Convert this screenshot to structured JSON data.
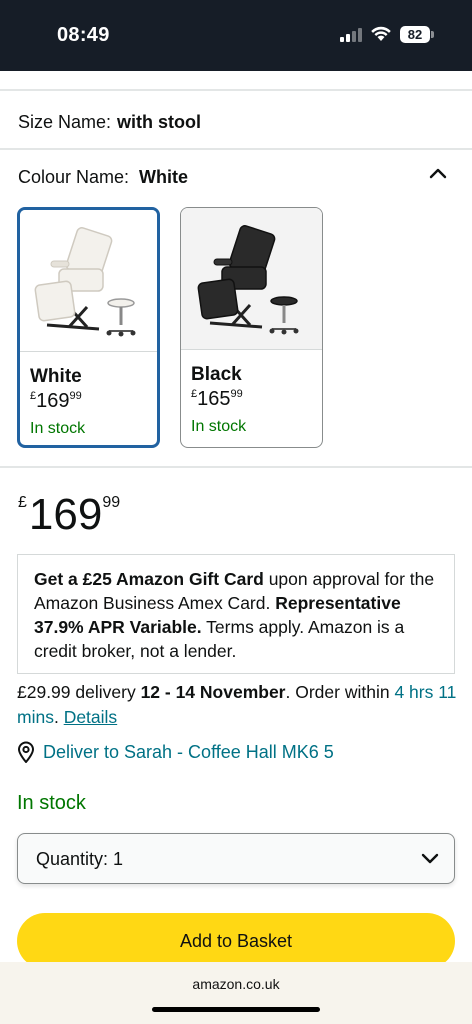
{
  "status_bar": {
    "time": "08:49",
    "battery": "82"
  },
  "size": {
    "label": "Size Name:",
    "value": "with stool"
  },
  "colour": {
    "label": "Colour Name:",
    "value": "White"
  },
  "swatches": [
    {
      "name": "White",
      "currency": "£",
      "price_whole": "169",
      "price_fraction": "99",
      "stock": "In stock",
      "selected": true,
      "chair_color": "#f3f1ec"
    },
    {
      "name": "Black",
      "currency": "£",
      "price_whole": "165",
      "price_fraction": "99",
      "stock": "In stock",
      "selected": false,
      "chair_color": "#2a2a2a"
    }
  ],
  "price": {
    "currency": "£",
    "whole": "169",
    "fraction": "99"
  },
  "promo": {
    "bold1": "Get a £25 Amazon Gift Card",
    "text1": " upon approval for the Amazon Business Amex Card. ",
    "bold2": "Representative 37.9% APR Variable.",
    "text2": " Terms apply. Amazon is a credit broker, not a lender."
  },
  "delivery": {
    "prefix": "£29.99 delivery ",
    "dates": "12 - 14 November",
    "middle": ". Order within ",
    "countdown": "4 hrs 11 mins",
    "sep": ". ",
    "details_link": "Details"
  },
  "deliver_to": "Deliver to Sarah - Coffee Hall MK6 5",
  "stock": "In stock",
  "quantity": "Quantity:  1",
  "add_to_basket": "Add to Basket",
  "url": "amazon.co.uk",
  "colors": {
    "link": "#007185",
    "in_stock": "#007600",
    "basket_button": "#ffd814",
    "selected_border": "#2162a1"
  }
}
